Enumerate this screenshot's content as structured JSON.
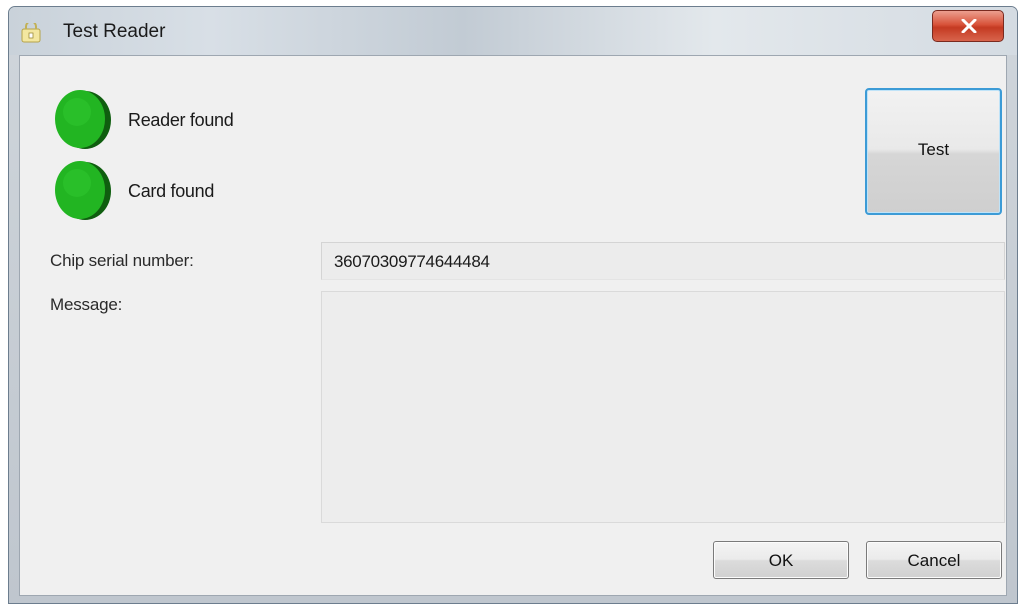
{
  "window": {
    "title": "Test Reader",
    "close_icon": "close-icon"
  },
  "status": {
    "reader_label": "Reader found",
    "reader_state": "green",
    "card_label": "Card found",
    "card_state": "green"
  },
  "fields": {
    "chip_serial_label": "Chip serial number:",
    "chip_serial_value": "360703097746444​84",
    "message_label": "Message:",
    "message_value": ""
  },
  "buttons": {
    "test_label": "Test",
    "ok_label": "OK",
    "cancel_label": "Cancel"
  },
  "colors": {
    "led_green": "#22b522",
    "focus_border": "#3c9bd6",
    "close_red": "#c43a22"
  }
}
